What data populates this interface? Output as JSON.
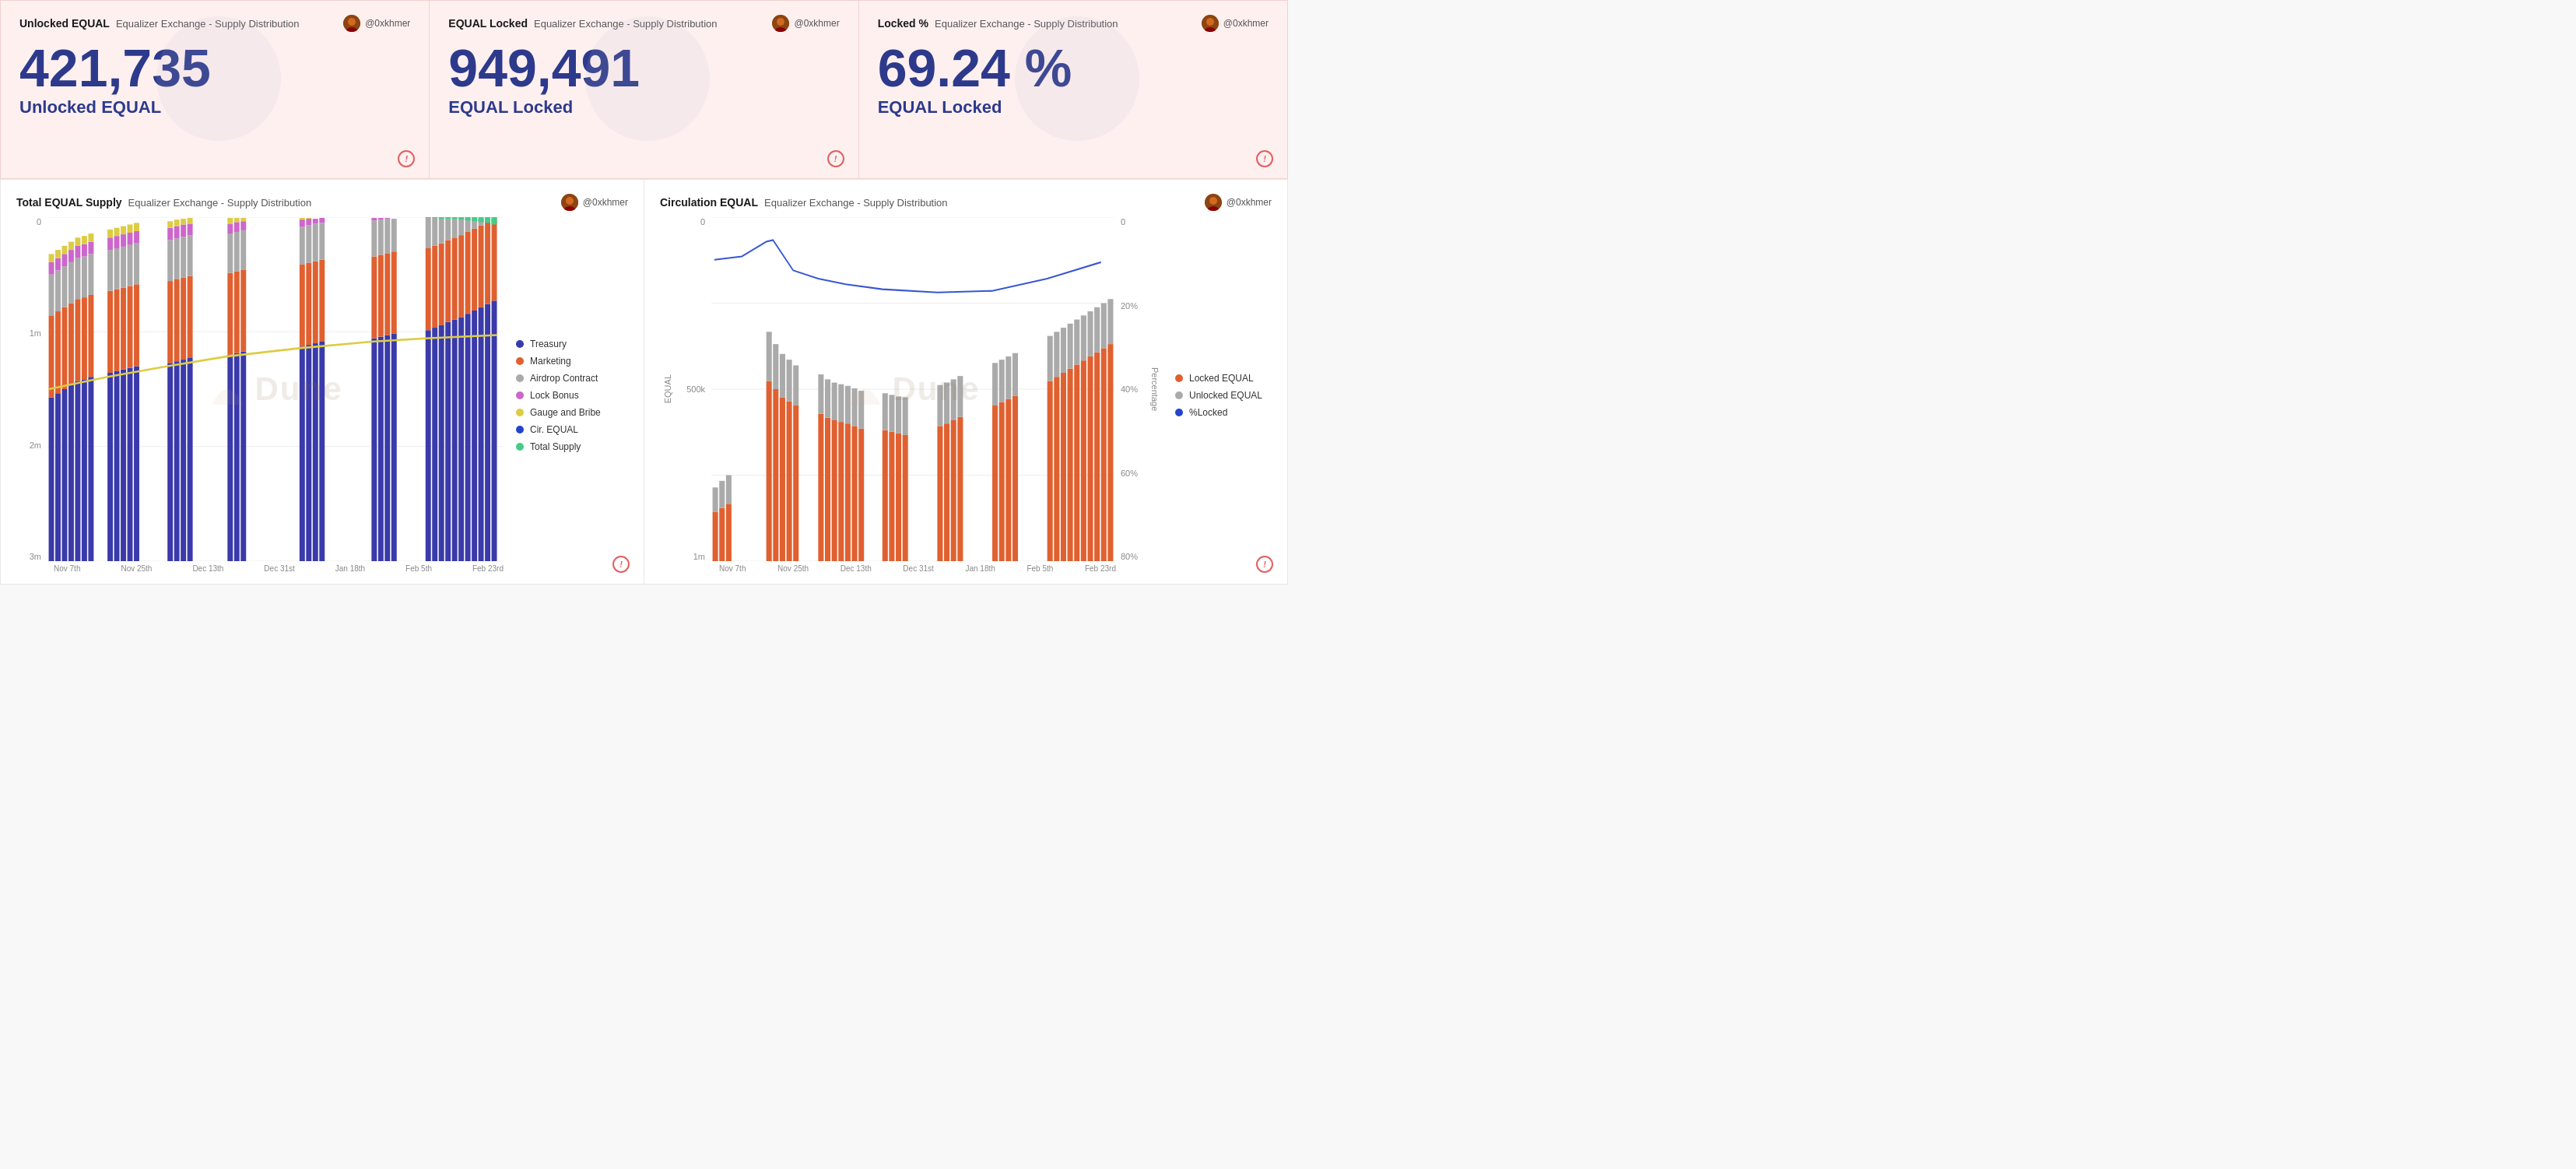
{
  "cards": [
    {
      "id": "unlocked-equal",
      "title_main": "Unlocked EQUAL",
      "subtitle": "Equalizer Exchange - Supply Distribution",
      "user": "@0xkhmer",
      "value": "421,735",
      "label": "Unlocked EQUAL"
    },
    {
      "id": "equal-locked",
      "title_main": "EQUAL Locked",
      "subtitle": "Equalizer Exchange - Supply Distribution",
      "user": "@0xkhmer",
      "value": "949,491",
      "label": "EQUAL Locked"
    },
    {
      "id": "locked-pct",
      "title_main": "Locked %",
      "subtitle": "Equalizer Exchange - Supply Distribution",
      "user": "@0xkhmer",
      "value": "69.24 %",
      "label": "EQUAL Locked"
    }
  ],
  "charts": [
    {
      "id": "total-supply",
      "title_main": "Total EQUAL Supply",
      "subtitle": "Equalizer Exchange - Supply Distribution",
      "user": "@0xkhmer",
      "y_labels": [
        "0",
        "1m",
        "2m",
        "3m"
      ],
      "x_labels": [
        "Nov 7th",
        "Nov 25th",
        "Dec 13th",
        "Dec 31st",
        "Jan 18th",
        "Feb 5th",
        "Feb 23rd"
      ],
      "legend": [
        {
          "label": "Treasury",
          "color": "#3a3aaa"
        },
        {
          "label": "Marketing",
          "color": "#e06030"
        },
        {
          "label": "Airdrop Contract",
          "color": "#aaaaaa"
        },
        {
          "label": "Lock Bonus",
          "color": "#cc66cc"
        },
        {
          "label": "Gauge and Bribe",
          "color": "#ddcc44"
        },
        {
          "label": "Cir. EQUAL",
          "color": "#2244cc"
        },
        {
          "label": "Total Supply",
          "color": "#44cc88"
        }
      ]
    },
    {
      "id": "circulation-equal",
      "title_main": "Circulation EQUAL",
      "subtitle": "Equalizer Exchange - Supply Distribution",
      "user": "@0xkhmer",
      "y_labels_left": [
        "0",
        "500k",
        "1m"
      ],
      "y_labels_right": [
        "0",
        "20%",
        "40%",
        "60%",
        "80%"
      ],
      "x_labels": [
        "Nov 7th",
        "Nov 25th",
        "Dec 13th",
        "Dec 31st",
        "Jan 18th",
        "Feb 5th",
        "Feb 23rd"
      ],
      "y_axis_label": "EQUAL",
      "y_axis_right_label": "Percentage",
      "legend": [
        {
          "label": "Locked EQUAL",
          "color": "#e06030"
        },
        {
          "label": "Unlocked EQUAL",
          "color": "#aaaaaa"
        },
        {
          "label": "%Locked",
          "color": "#2244cc"
        }
      ]
    }
  ]
}
